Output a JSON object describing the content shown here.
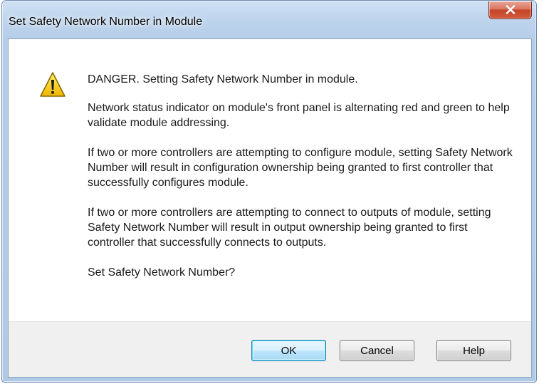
{
  "window": {
    "title": "Set Safety Network Number in Module"
  },
  "icon": {
    "name": "warning-icon"
  },
  "message": {
    "heading": "DANGER. Setting Safety Network Number in module.",
    "paragraph1": "Network status indicator on module's front panel is alternating red and green to help validate module addressing.",
    "paragraph2": "If two or more controllers are attempting to configure module, setting Safety Network Number will result in configuration ownership being granted to first controller that successfully configures module.",
    "paragraph3": "If two or more controllers are attempting to connect to outputs of module, setting Safety Network Number will result in output ownership being granted to first controller that successfully connects to outputs.",
    "question": "Set Safety Network Number?"
  },
  "buttons": {
    "ok": "OK",
    "cancel": "Cancel",
    "help": "Help"
  },
  "colors": {
    "close_button": "#c44428",
    "title_bar": "#bcd3ec",
    "warning_yellow": "#f5c400",
    "default_button_border": "#3c7fb1"
  }
}
